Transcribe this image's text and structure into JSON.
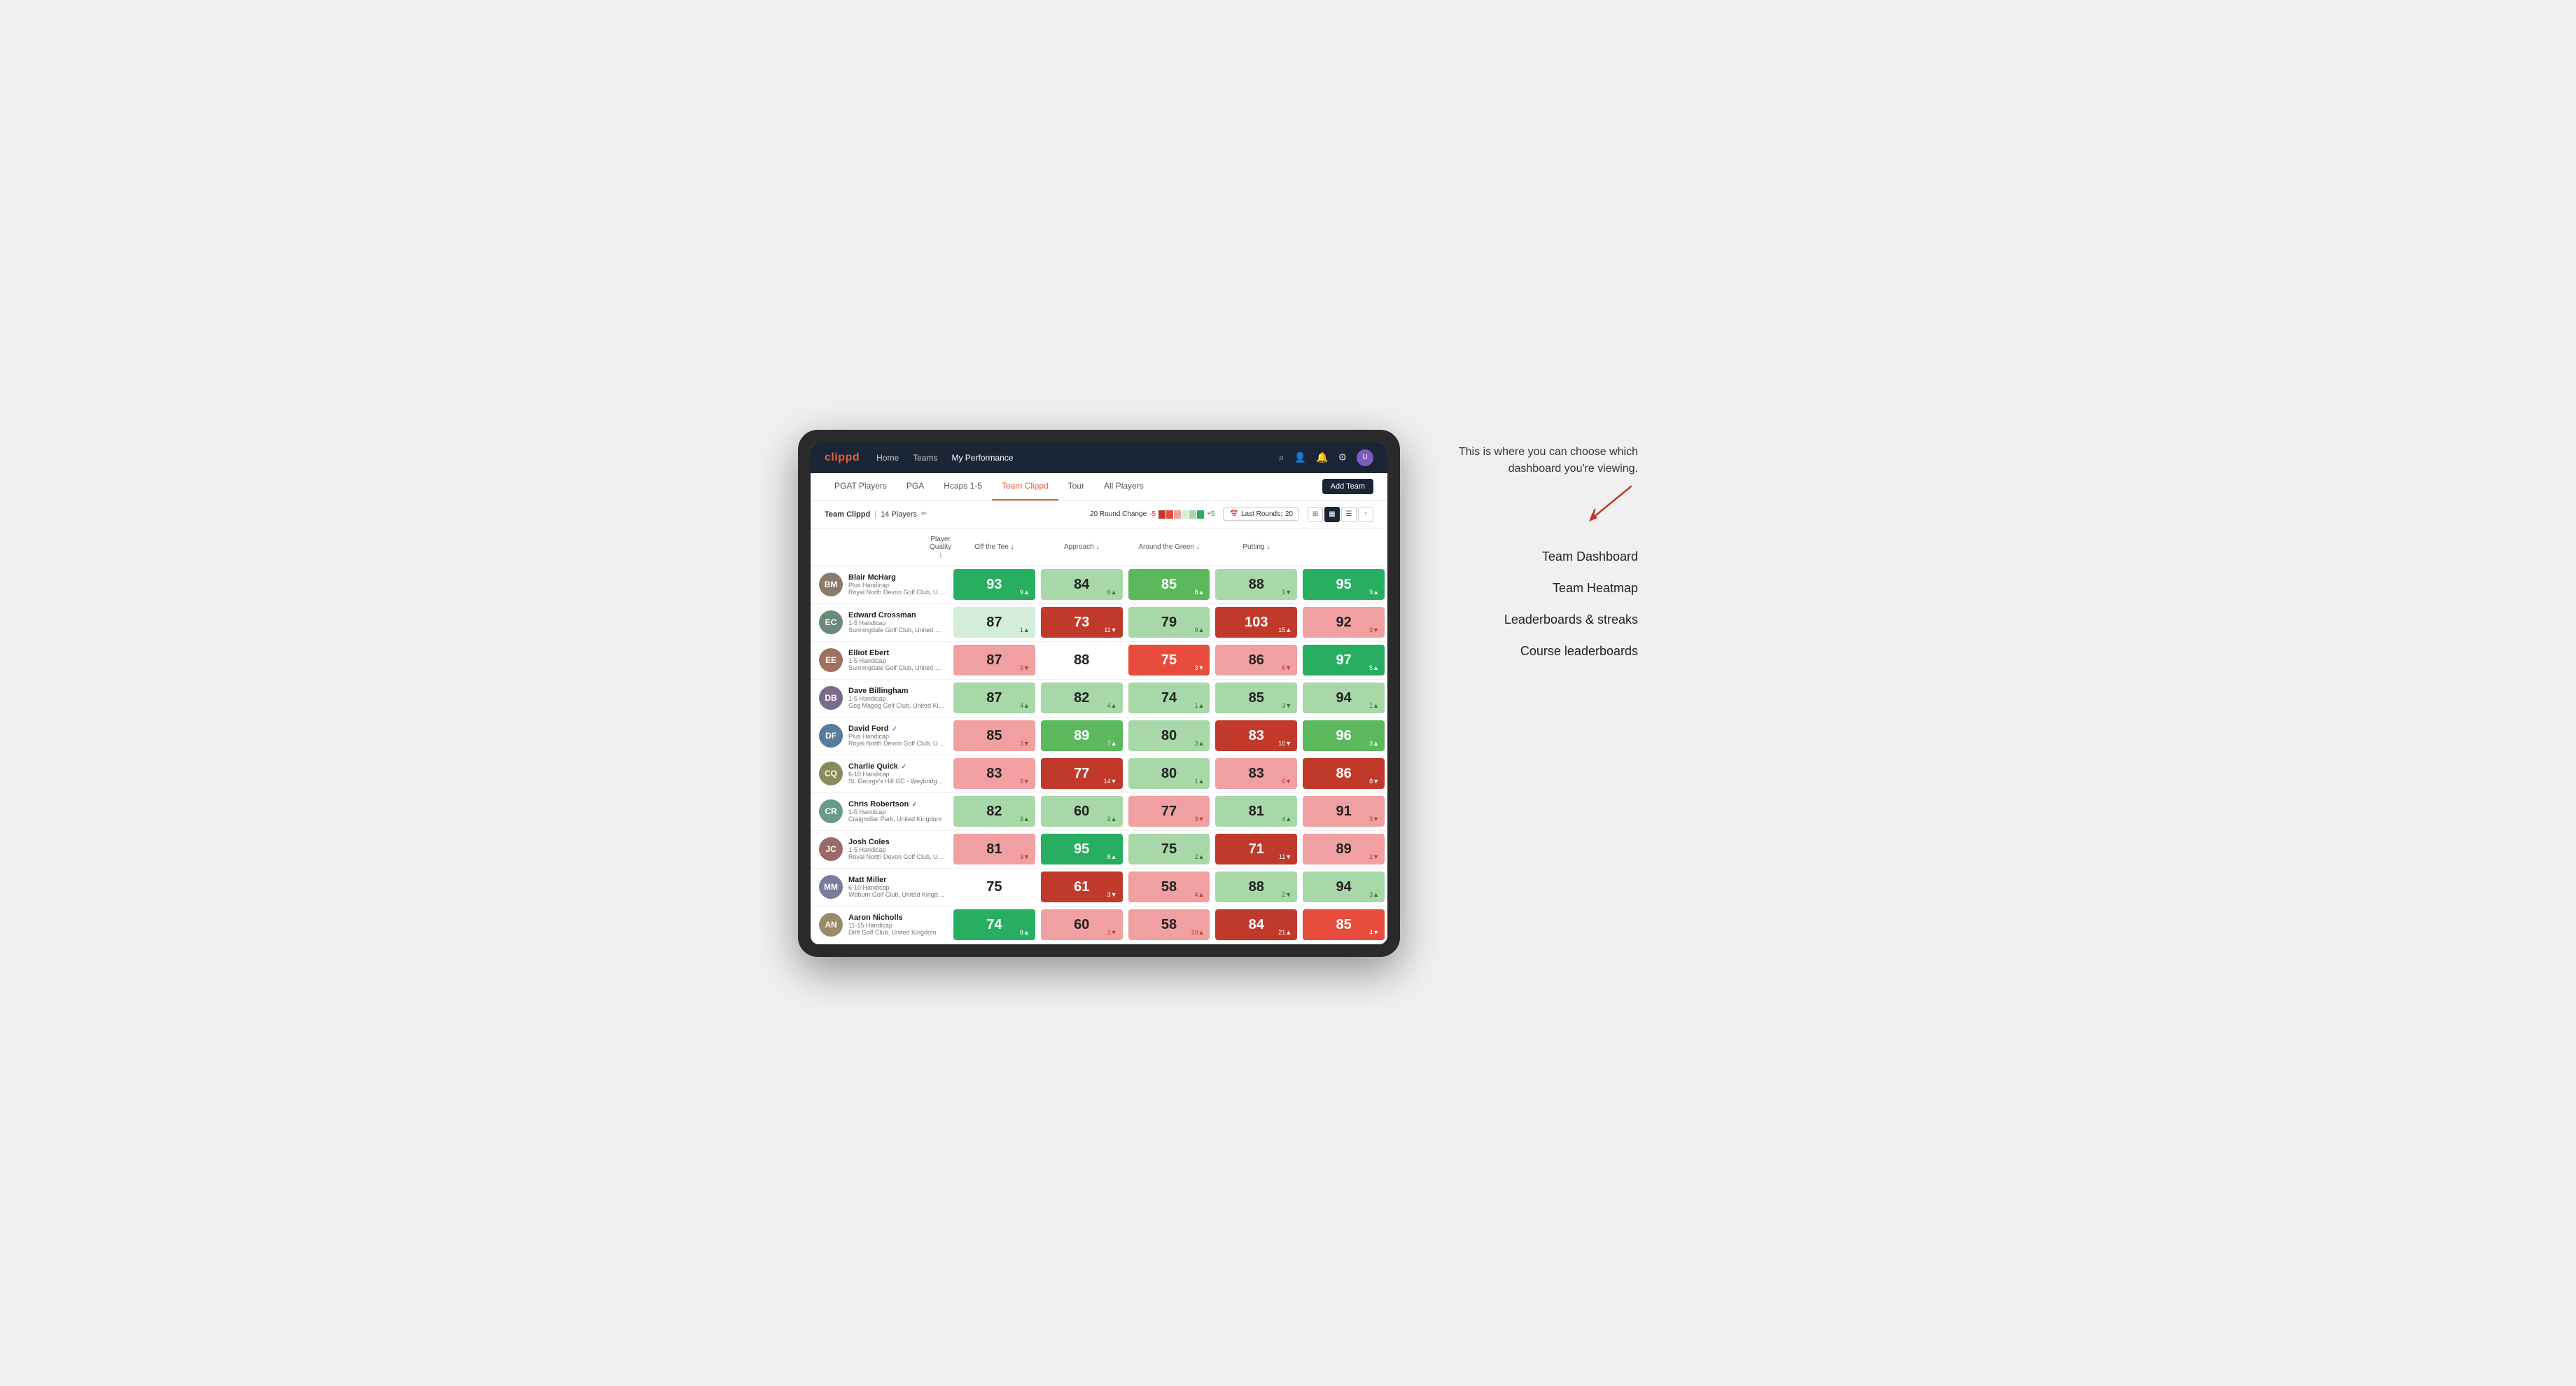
{
  "annotation": {
    "intro": "This is where you can choose which dashboard you're viewing.",
    "items": [
      "Team Dashboard",
      "Team Heatmap",
      "Leaderboards & streaks",
      "Course leaderboards"
    ]
  },
  "nav": {
    "logo": "clippd",
    "links": [
      "Home",
      "Teams",
      "My Performance"
    ],
    "active_link": "My Performance"
  },
  "sub_nav": {
    "tabs": [
      "PGAT Players",
      "PGA",
      "Hcaps 1-5",
      "Team Clippd",
      "Tour",
      "All Players"
    ],
    "active_tab": "Team Clippd",
    "add_team_label": "Add Team"
  },
  "team_header": {
    "team_name": "Team Clippd",
    "player_count": "14 Players",
    "round_change_label": "20 Round Change",
    "neg_val": "-5",
    "pos_val": "+5",
    "last_rounds_label": "Last Rounds:",
    "last_rounds_count": "20"
  },
  "table": {
    "columns": [
      "Player Quality ↓",
      "Off the Tee ↓",
      "Approach ↓",
      "Around the Green ↓",
      "Putting ↓"
    ],
    "players": [
      {
        "name": "Blair McHarg",
        "handicap": "Plus Handicap",
        "club": "Royal North Devon Golf Club, United Kingdom",
        "initials": "BM",
        "avatar_color": "#8b7a6a",
        "scores": [
          {
            "val": "93",
            "change": "9▲",
            "dir": "up",
            "bg": "green-strong"
          },
          {
            "val": "84",
            "change": "6▲",
            "dir": "up",
            "bg": "green-light"
          },
          {
            "val": "85",
            "change": "8▲",
            "dir": "up",
            "bg": "green-mid"
          },
          {
            "val": "88",
            "change": "1▼",
            "dir": "down",
            "bg": "green-light"
          },
          {
            "val": "95",
            "change": "9▲",
            "dir": "up",
            "bg": "green-strong"
          }
        ]
      },
      {
        "name": "Edward Crossman",
        "handicap": "1-5 Handicap",
        "club": "Sunningdale Golf Club, United Kingdom",
        "initials": "EC",
        "avatar_color": "#6a8b7a",
        "scores": [
          {
            "val": "87",
            "change": "1▲",
            "dir": "up",
            "bg": "green-pale"
          },
          {
            "val": "73",
            "change": "11▼",
            "dir": "down",
            "bg": "red-strong"
          },
          {
            "val": "79",
            "change": "9▲",
            "dir": "up",
            "bg": "green-light"
          },
          {
            "val": "103",
            "change": "15▲",
            "dir": "up",
            "bg": "red-strong"
          },
          {
            "val": "92",
            "change": "3▼",
            "dir": "down",
            "bg": "red-light"
          }
        ]
      },
      {
        "name": "Elliot Ebert",
        "handicap": "1-5 Handicap",
        "club": "Sunningdale Golf Club, United Kingdom",
        "initials": "EE",
        "avatar_color": "#a07060",
        "scores": [
          {
            "val": "87",
            "change": "3▼",
            "dir": "down",
            "bg": "red-light"
          },
          {
            "val": "88",
            "change": "",
            "dir": "",
            "bg": "white"
          },
          {
            "val": "75",
            "change": "3▼",
            "dir": "down",
            "bg": "red-mid"
          },
          {
            "val": "86",
            "change": "6▼",
            "dir": "down",
            "bg": "red-light"
          },
          {
            "val": "97",
            "change": "5▲",
            "dir": "up",
            "bg": "green-strong"
          }
        ]
      },
      {
        "name": "Dave Billingham",
        "handicap": "1-5 Handicap",
        "club": "Gog Magog Golf Club, United Kingdom",
        "initials": "DB",
        "avatar_color": "#7a6a8b",
        "scores": [
          {
            "val": "87",
            "change": "4▲",
            "dir": "up",
            "bg": "green-light"
          },
          {
            "val": "82",
            "change": "4▲",
            "dir": "up",
            "bg": "green-light"
          },
          {
            "val": "74",
            "change": "1▲",
            "dir": "up",
            "bg": "green-light"
          },
          {
            "val": "85",
            "change": "3▼",
            "dir": "down",
            "bg": "green-light"
          },
          {
            "val": "94",
            "change": "1▲",
            "dir": "up",
            "bg": "green-light"
          }
        ]
      },
      {
        "name": "David Ford",
        "handicap": "Plus Handicap",
        "club": "Royal North Devon Golf Club, United Kingdom",
        "initials": "DF",
        "avatar_color": "#5a7a9a",
        "verified": true,
        "scores": [
          {
            "val": "85",
            "change": "3▼",
            "dir": "down",
            "bg": "red-light"
          },
          {
            "val": "89",
            "change": "7▲",
            "dir": "up",
            "bg": "green-mid"
          },
          {
            "val": "80",
            "change": "3▲",
            "dir": "up",
            "bg": "green-light"
          },
          {
            "val": "83",
            "change": "10▼",
            "dir": "down",
            "bg": "red-strong"
          },
          {
            "val": "96",
            "change": "3▲",
            "dir": "up",
            "bg": "green-mid"
          }
        ]
      },
      {
        "name": "Charlie Quick",
        "handicap": "6-10 Handicap",
        "club": "St. George's Hill GC - Weybridge - Surrey, Uni...",
        "initials": "CQ",
        "avatar_color": "#8a8a5a",
        "verified": true,
        "scores": [
          {
            "val": "83",
            "change": "3▼",
            "dir": "down",
            "bg": "red-light"
          },
          {
            "val": "77",
            "change": "14▼",
            "dir": "down",
            "bg": "red-strong"
          },
          {
            "val": "80",
            "change": "1▲",
            "dir": "up",
            "bg": "green-light"
          },
          {
            "val": "83",
            "change": "6▼",
            "dir": "down",
            "bg": "red-light"
          },
          {
            "val": "86",
            "change": "8▼",
            "dir": "down",
            "bg": "red-strong"
          }
        ]
      },
      {
        "name": "Chris Robertson",
        "handicap": "1-5 Handicap",
        "club": "Craigmillar Park, United Kingdom",
        "initials": "CR",
        "avatar_color": "#6a9a8a",
        "verified": true,
        "scores": [
          {
            "val": "82",
            "change": "3▲",
            "dir": "up",
            "bg": "green-light"
          },
          {
            "val": "60",
            "change": "2▲",
            "dir": "up",
            "bg": "green-light"
          },
          {
            "val": "77",
            "change": "3▼",
            "dir": "down",
            "bg": "red-light"
          },
          {
            "val": "81",
            "change": "4▲",
            "dir": "up",
            "bg": "green-light"
          },
          {
            "val": "91",
            "change": "3▼",
            "dir": "down",
            "bg": "red-light"
          }
        ]
      },
      {
        "name": "Josh Coles",
        "handicap": "1-5 Handicap",
        "club": "Royal North Devon Golf Club, United Kingdom",
        "initials": "JC",
        "avatar_color": "#9a6a6a",
        "scores": [
          {
            "val": "81",
            "change": "3▼",
            "dir": "down",
            "bg": "red-light"
          },
          {
            "val": "95",
            "change": "8▲",
            "dir": "up",
            "bg": "green-strong"
          },
          {
            "val": "75",
            "change": "2▲",
            "dir": "up",
            "bg": "green-light"
          },
          {
            "val": "71",
            "change": "11▼",
            "dir": "down",
            "bg": "red-strong"
          },
          {
            "val": "89",
            "change": "2▼",
            "dir": "down",
            "bg": "red-light"
          }
        ]
      },
      {
        "name": "Matt Miller",
        "handicap": "6-10 Handicap",
        "club": "Woburn Golf Club, United Kingdom",
        "initials": "MM",
        "avatar_color": "#7a7a9a",
        "scores": [
          {
            "val": "75",
            "change": "",
            "dir": "",
            "bg": "white"
          },
          {
            "val": "61",
            "change": "3▼",
            "dir": "down",
            "bg": "red-strong"
          },
          {
            "val": "58",
            "change": "4▲",
            "dir": "up",
            "bg": "red-light"
          },
          {
            "val": "88",
            "change": "2▼",
            "dir": "down",
            "bg": "green-light"
          },
          {
            "val": "94",
            "change": "3▲",
            "dir": "up",
            "bg": "green-light"
          }
        ]
      },
      {
        "name": "Aaron Nicholls",
        "handicap": "11-15 Handicap",
        "club": "Drift Golf Club, United Kingdom",
        "initials": "AN",
        "avatar_color": "#9a8a6a",
        "scores": [
          {
            "val": "74",
            "change": "8▲",
            "dir": "up",
            "bg": "green-strong"
          },
          {
            "val": "60",
            "change": "1▼",
            "dir": "down",
            "bg": "red-light"
          },
          {
            "val": "58",
            "change": "10▲",
            "dir": "up",
            "bg": "red-light"
          },
          {
            "val": "84",
            "change": "21▲",
            "dir": "up",
            "bg": "red-strong"
          },
          {
            "val": "85",
            "change": "4▼",
            "dir": "down",
            "bg": "red-mid"
          }
        ]
      }
    ]
  }
}
